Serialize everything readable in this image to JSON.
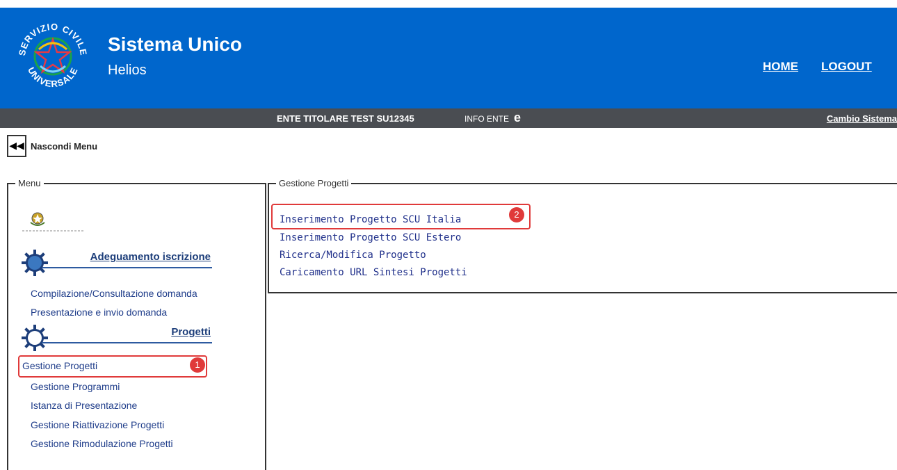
{
  "header": {
    "logo_text_top": "SERVIZIO CIVILE",
    "logo_text_bottom": "UNIVERSALE",
    "title": "Sistema Unico",
    "subtitle": "Helios",
    "home_link": "HOME",
    "logout_link": "LOGOUT"
  },
  "infobar": {
    "ente": "ENTE TITOLARE TEST  SU12345",
    "info": "INFO ENTE",
    "e_icon": "e",
    "cambio": "Cambio Sistema"
  },
  "hide_menu": {
    "label": "Nascondi Menu",
    "icon": "rewind-icon"
  },
  "menu": {
    "legend": "Menu",
    "sections": [
      {
        "title": "Adeguamento iscrizione",
        "items": [
          "Compilazione/Consultazione domanda",
          "Presentazione e invio domanda"
        ]
      },
      {
        "title": "Progetti",
        "items": [
          "Gestione Progetti",
          "Gestione Programmi",
          "Istanza di Presentazione",
          "Gestione Riattivazione Progetti",
          "Gestione Rimodulazione Progetti"
        ]
      }
    ]
  },
  "progetti": {
    "legend": "Gestione Progetti",
    "links": [
      "Inserimento Progetto SCU Italia",
      "Inserimento Progetto SCU Estero",
      "Ricerca/Modifica Progetto",
      "Caricamento URL Sintesi Progetti"
    ]
  },
  "annotations": {
    "badge1": "1",
    "badge2": "2",
    "color": "#e03a3a"
  },
  "colors": {
    "brand_blue": "#0066cc",
    "info_bar": "#4a4d52",
    "link_blue": "#1f3d8a"
  }
}
